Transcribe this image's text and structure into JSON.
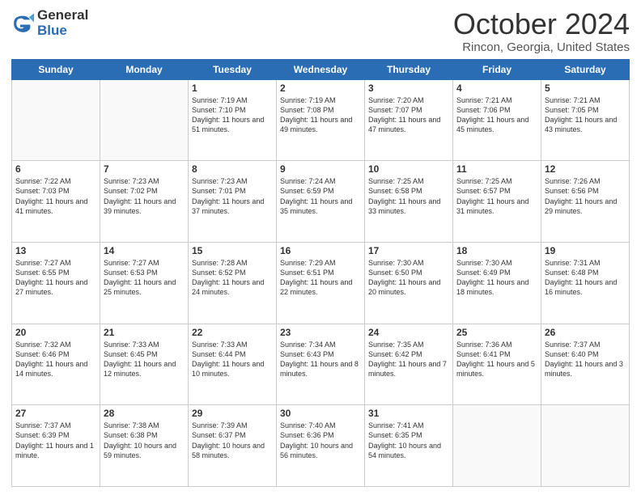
{
  "logo": {
    "general": "General",
    "blue": "Blue"
  },
  "header": {
    "title": "October 2024",
    "location": "Rincon, Georgia, United States"
  },
  "weekdays": [
    "Sunday",
    "Monday",
    "Tuesday",
    "Wednesday",
    "Thursday",
    "Friday",
    "Saturday"
  ],
  "weeks": [
    [
      {
        "day": null
      },
      {
        "day": null
      },
      {
        "day": 1,
        "sunrise": "Sunrise: 7:19 AM",
        "sunset": "Sunset: 7:10 PM",
        "daylight": "Daylight: 11 hours and 51 minutes."
      },
      {
        "day": 2,
        "sunrise": "Sunrise: 7:19 AM",
        "sunset": "Sunset: 7:08 PM",
        "daylight": "Daylight: 11 hours and 49 minutes."
      },
      {
        "day": 3,
        "sunrise": "Sunrise: 7:20 AM",
        "sunset": "Sunset: 7:07 PM",
        "daylight": "Daylight: 11 hours and 47 minutes."
      },
      {
        "day": 4,
        "sunrise": "Sunrise: 7:21 AM",
        "sunset": "Sunset: 7:06 PM",
        "daylight": "Daylight: 11 hours and 45 minutes."
      },
      {
        "day": 5,
        "sunrise": "Sunrise: 7:21 AM",
        "sunset": "Sunset: 7:05 PM",
        "daylight": "Daylight: 11 hours and 43 minutes."
      }
    ],
    [
      {
        "day": 6,
        "sunrise": "Sunrise: 7:22 AM",
        "sunset": "Sunset: 7:03 PM",
        "daylight": "Daylight: 11 hours and 41 minutes."
      },
      {
        "day": 7,
        "sunrise": "Sunrise: 7:23 AM",
        "sunset": "Sunset: 7:02 PM",
        "daylight": "Daylight: 11 hours and 39 minutes."
      },
      {
        "day": 8,
        "sunrise": "Sunrise: 7:23 AM",
        "sunset": "Sunset: 7:01 PM",
        "daylight": "Daylight: 11 hours and 37 minutes."
      },
      {
        "day": 9,
        "sunrise": "Sunrise: 7:24 AM",
        "sunset": "Sunset: 6:59 PM",
        "daylight": "Daylight: 11 hours and 35 minutes."
      },
      {
        "day": 10,
        "sunrise": "Sunrise: 7:25 AM",
        "sunset": "Sunset: 6:58 PM",
        "daylight": "Daylight: 11 hours and 33 minutes."
      },
      {
        "day": 11,
        "sunrise": "Sunrise: 7:25 AM",
        "sunset": "Sunset: 6:57 PM",
        "daylight": "Daylight: 11 hours and 31 minutes."
      },
      {
        "day": 12,
        "sunrise": "Sunrise: 7:26 AM",
        "sunset": "Sunset: 6:56 PM",
        "daylight": "Daylight: 11 hours and 29 minutes."
      }
    ],
    [
      {
        "day": 13,
        "sunrise": "Sunrise: 7:27 AM",
        "sunset": "Sunset: 6:55 PM",
        "daylight": "Daylight: 11 hours and 27 minutes."
      },
      {
        "day": 14,
        "sunrise": "Sunrise: 7:27 AM",
        "sunset": "Sunset: 6:53 PM",
        "daylight": "Daylight: 11 hours and 25 minutes."
      },
      {
        "day": 15,
        "sunrise": "Sunrise: 7:28 AM",
        "sunset": "Sunset: 6:52 PM",
        "daylight": "Daylight: 11 hours and 24 minutes."
      },
      {
        "day": 16,
        "sunrise": "Sunrise: 7:29 AM",
        "sunset": "Sunset: 6:51 PM",
        "daylight": "Daylight: 11 hours and 22 minutes."
      },
      {
        "day": 17,
        "sunrise": "Sunrise: 7:30 AM",
        "sunset": "Sunset: 6:50 PM",
        "daylight": "Daylight: 11 hours and 20 minutes."
      },
      {
        "day": 18,
        "sunrise": "Sunrise: 7:30 AM",
        "sunset": "Sunset: 6:49 PM",
        "daylight": "Daylight: 11 hours and 18 minutes."
      },
      {
        "day": 19,
        "sunrise": "Sunrise: 7:31 AM",
        "sunset": "Sunset: 6:48 PM",
        "daylight": "Daylight: 11 hours and 16 minutes."
      }
    ],
    [
      {
        "day": 20,
        "sunrise": "Sunrise: 7:32 AM",
        "sunset": "Sunset: 6:46 PM",
        "daylight": "Daylight: 11 hours and 14 minutes."
      },
      {
        "day": 21,
        "sunrise": "Sunrise: 7:33 AM",
        "sunset": "Sunset: 6:45 PM",
        "daylight": "Daylight: 11 hours and 12 minutes."
      },
      {
        "day": 22,
        "sunrise": "Sunrise: 7:33 AM",
        "sunset": "Sunset: 6:44 PM",
        "daylight": "Daylight: 11 hours and 10 minutes."
      },
      {
        "day": 23,
        "sunrise": "Sunrise: 7:34 AM",
        "sunset": "Sunset: 6:43 PM",
        "daylight": "Daylight: 11 hours and 8 minutes."
      },
      {
        "day": 24,
        "sunrise": "Sunrise: 7:35 AM",
        "sunset": "Sunset: 6:42 PM",
        "daylight": "Daylight: 11 hours and 7 minutes."
      },
      {
        "day": 25,
        "sunrise": "Sunrise: 7:36 AM",
        "sunset": "Sunset: 6:41 PM",
        "daylight": "Daylight: 11 hours and 5 minutes."
      },
      {
        "day": 26,
        "sunrise": "Sunrise: 7:37 AM",
        "sunset": "Sunset: 6:40 PM",
        "daylight": "Daylight: 11 hours and 3 minutes."
      }
    ],
    [
      {
        "day": 27,
        "sunrise": "Sunrise: 7:37 AM",
        "sunset": "Sunset: 6:39 PM",
        "daylight": "Daylight: 11 hours and 1 minute."
      },
      {
        "day": 28,
        "sunrise": "Sunrise: 7:38 AM",
        "sunset": "Sunset: 6:38 PM",
        "daylight": "Daylight: 10 hours and 59 minutes."
      },
      {
        "day": 29,
        "sunrise": "Sunrise: 7:39 AM",
        "sunset": "Sunset: 6:37 PM",
        "daylight": "Daylight: 10 hours and 58 minutes."
      },
      {
        "day": 30,
        "sunrise": "Sunrise: 7:40 AM",
        "sunset": "Sunset: 6:36 PM",
        "daylight": "Daylight: 10 hours and 56 minutes."
      },
      {
        "day": 31,
        "sunrise": "Sunrise: 7:41 AM",
        "sunset": "Sunset: 6:35 PM",
        "daylight": "Daylight: 10 hours and 54 minutes."
      },
      {
        "day": null
      },
      {
        "day": null
      }
    ]
  ]
}
